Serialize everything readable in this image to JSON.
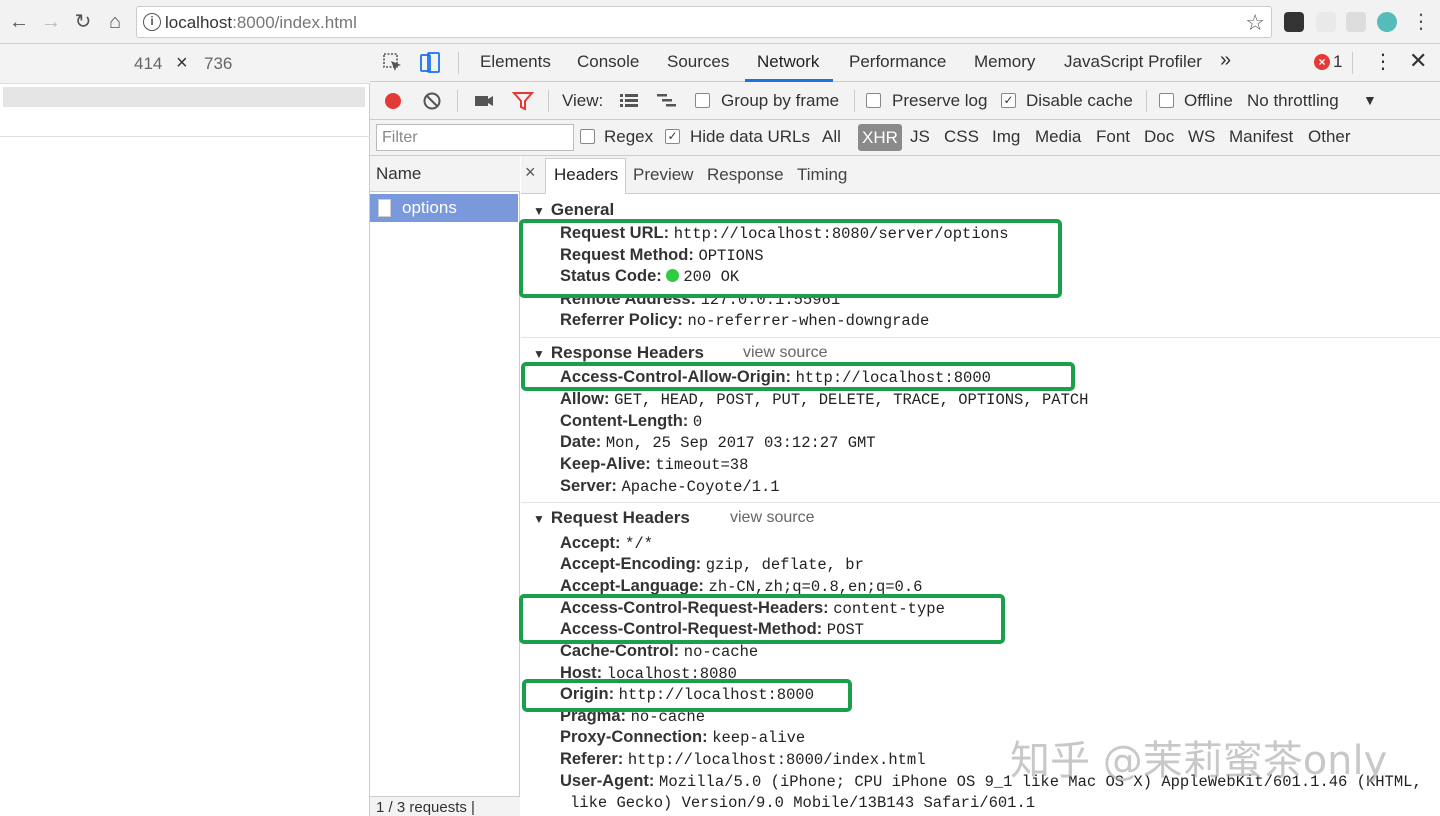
{
  "browser": {
    "url_host": "localhost",
    "url_path": ":8000/index.html"
  },
  "device": {
    "width": "414",
    "times": "×",
    "height": "736"
  },
  "devtools": {
    "tabs": [
      "Elements",
      "Console",
      "Sources",
      "Network",
      "Performance",
      "Memory",
      "JavaScript Profiler"
    ],
    "active_tab": "Network",
    "more": "»",
    "error_badge": "×",
    "error_count": "1"
  },
  "toolbar": {
    "view_label": "View:",
    "group_by_frame": "Group by frame",
    "preserve_log": "Preserve log",
    "disable_cache": "Disable cache",
    "offline": "Offline",
    "throttling": "No throttling",
    "checked_mark": "✓"
  },
  "filter": {
    "placeholder": "Filter",
    "regex": "Regex",
    "hide_data_urls": "Hide data URLs",
    "types": [
      "All",
      "XHR",
      "JS",
      "CSS",
      "Img",
      "Media",
      "Font",
      "Doc",
      "WS",
      "Manifest",
      "Other"
    ],
    "active_type": "XHR"
  },
  "requests": {
    "header": "Name",
    "items": [
      "options"
    ],
    "footer": "1 / 3 requests |"
  },
  "detail": {
    "close": "×",
    "tabs": [
      "Headers",
      "Preview",
      "Response",
      "Timing"
    ],
    "general": {
      "title": "General",
      "rows": [
        {
          "k": "Request URL:",
          "v": "http://localhost:8080/server/options"
        },
        {
          "k": "Request Method:",
          "v": "OPTIONS"
        },
        {
          "k": "Status Code:",
          "v": "200 OK"
        },
        {
          "k": "Remote Address:",
          "v": "127.0.0.1:55961"
        },
        {
          "k": "Referrer Policy:",
          "v": "no-referrer-when-downgrade"
        }
      ]
    },
    "response": {
      "title": "Response Headers",
      "view_source": "view source",
      "rows": [
        {
          "k": "Access-Control-Allow-Origin:",
          "v": "http://localhost:8000"
        },
        {
          "k": "Allow:",
          "v": "GET, HEAD, POST, PUT, DELETE, TRACE, OPTIONS, PATCH"
        },
        {
          "k": "Content-Length:",
          "v": "0"
        },
        {
          "k": "Date:",
          "v": "Mon, 25 Sep 2017 03:12:27 GMT"
        },
        {
          "k": "Keep-Alive:",
          "v": "timeout=38"
        },
        {
          "k": "Server:",
          "v": "Apache-Coyote/1.1"
        }
      ]
    },
    "request": {
      "title": "Request Headers",
      "view_source": "view source",
      "rows": [
        {
          "k": "Accept:",
          "v": "*/*"
        },
        {
          "k": "Accept-Encoding:",
          "v": "gzip, deflate, br"
        },
        {
          "k": "Accept-Language:",
          "v": "zh-CN,zh;q=0.8,en;q=0.6"
        },
        {
          "k": "Access-Control-Request-Headers:",
          "v": "content-type"
        },
        {
          "k": "Access-Control-Request-Method:",
          "v": "POST"
        },
        {
          "k": "Cache-Control:",
          "v": "no-cache"
        },
        {
          "k": "Host:",
          "v": "localhost:8080"
        },
        {
          "k": "Origin:",
          "v": "http://localhost:8000"
        },
        {
          "k": "Pragma:",
          "v": "no-cache"
        },
        {
          "k": "Proxy-Connection:",
          "v": "keep-alive"
        },
        {
          "k": "Referer:",
          "v": "http://localhost:8000/index.html"
        },
        {
          "k": "User-Agent:",
          "v": "Mozilla/5.0 (iPhone; CPU iPhone OS 9_1 like Mac OS X) AppleWebKit/601.1.46 (KHTML,"
        }
      ],
      "ua_continuation": "like Gecko) Version/9.0 Mobile/13B143 Safari/601.1"
    }
  },
  "watermark": "知乎 @茉莉蜜茶only",
  "colors": {
    "highlight": "#1aa04a",
    "selected_row": "#7a99dc",
    "record": "#e53935",
    "active_tab_underline": "#1a73e8"
  }
}
